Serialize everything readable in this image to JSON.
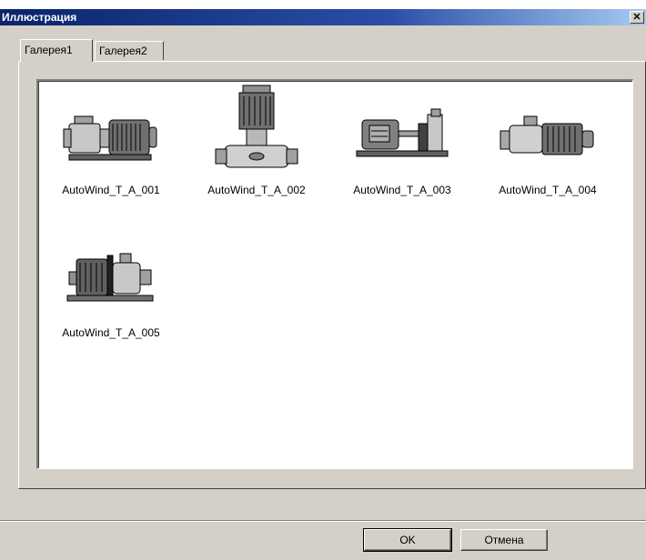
{
  "window": {
    "title": "Иллюстрация",
    "close_glyph": "✕"
  },
  "tabs": [
    {
      "label": "Галерея1",
      "active": true
    },
    {
      "label": "Галерея2",
      "active": false
    }
  ],
  "gallery": {
    "items": [
      {
        "label": "AutoWind_T_A_001",
        "icon": "horizontal-pump-icon"
      },
      {
        "label": "AutoWind_T_A_002",
        "icon": "vertical-pump-icon"
      },
      {
        "label": "AutoWind_T_A_003",
        "icon": "motor-pump-base-icon"
      },
      {
        "label": "AutoWind_T_A_004",
        "icon": "inline-pump-icon"
      },
      {
        "label": "AutoWind_T_A_005",
        "icon": "monoblock-pump-icon"
      }
    ]
  },
  "buttons": {
    "ok": "OK",
    "cancel": "Отмена"
  }
}
